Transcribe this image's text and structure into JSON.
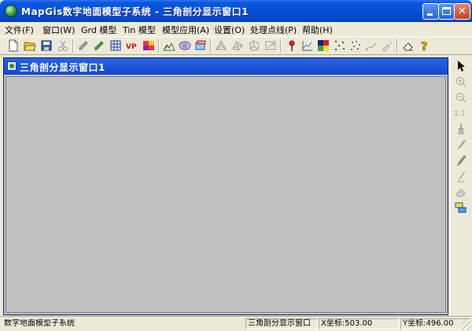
{
  "window": {
    "title": "MapGis数字地面模型子系统 - 三角剖分显示窗口1",
    "controls": {
      "minimize": "_",
      "maximize": "□",
      "close": "✕"
    }
  },
  "menu": [
    {
      "label": "文件(F)"
    },
    {
      "label": "窗口(W)"
    },
    {
      "label": "Grd 模型"
    },
    {
      "label": "Tin 模型"
    },
    {
      "label": "模型应用(A)"
    },
    {
      "label": "设置(O)"
    },
    {
      "label": "处理点线(P)"
    },
    {
      "label": "帮助(H)"
    }
  ],
  "toolbar": [
    {
      "icon": "new-file-icon"
    },
    {
      "icon": "open-folder-icon"
    },
    {
      "icon": "save-icon"
    },
    {
      "icon": "cut-icon"
    },
    {
      "icon": "pencil-gray-icon"
    },
    {
      "icon": "pencil-green-icon"
    },
    {
      "icon": "grid-icon"
    },
    {
      "icon": "vp-icon",
      "text": "VP"
    },
    {
      "icon": "color-blocks-icon"
    },
    {
      "icon": "terrain-icon"
    },
    {
      "icon": "contour-icon"
    },
    {
      "icon": "layer-icon"
    },
    {
      "icon": "tin-icon"
    },
    {
      "icon": "network-icon"
    },
    {
      "icon": "voronoi-icon"
    },
    {
      "icon": "arrow-icon"
    },
    {
      "icon": "probe-icon"
    },
    {
      "icon": "profile-chart-icon"
    },
    {
      "icon": "color-map-icon"
    },
    {
      "icon": "points-icon"
    },
    {
      "icon": "scatter-icon"
    },
    {
      "icon": "curve-icon"
    },
    {
      "icon": "spray-icon"
    },
    {
      "icon": "eraser-icon"
    },
    {
      "icon": "help-icon",
      "text": "?"
    }
  ],
  "child_window": {
    "title": "三角剖分显示窗口1"
  },
  "right_tools": [
    {
      "icon": "select-arrow-icon"
    },
    {
      "icon": "zoom-in-icon"
    },
    {
      "icon": "zoom-out-icon"
    },
    {
      "icon": "actual-size-icon",
      "text": "1:1"
    },
    {
      "icon": "brush-icon"
    },
    {
      "icon": "pencil-icon"
    },
    {
      "icon": "pen-icon"
    },
    {
      "icon": "thin-pen-icon"
    },
    {
      "icon": "eraser-icon"
    },
    {
      "icon": "layers-icon"
    }
  ],
  "status": {
    "message": "数字地面模型子系统",
    "window": "三角剖分显示窗口",
    "x_label": "X坐标:",
    "x_value": "503.00",
    "y_label": "Y坐标:",
    "y_value": "496.00"
  },
  "colors": {
    "titlebar": "#0650d6",
    "child_title": "#1f56d6",
    "canvas": "#c0c0c0",
    "chrome": "#ece9d8"
  }
}
